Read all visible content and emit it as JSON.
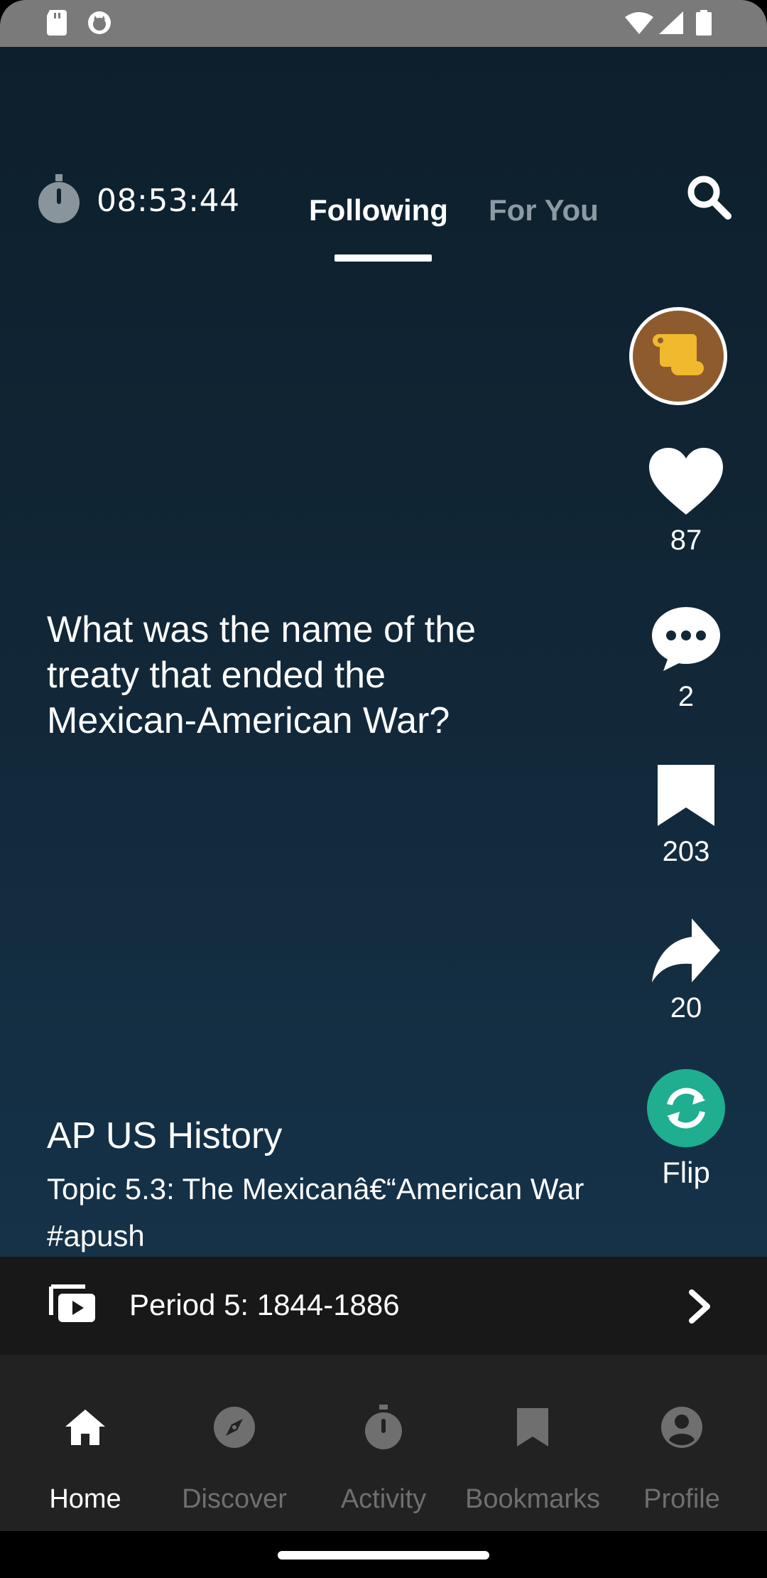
{
  "status_bar": {
    "left_icons": [
      "sd-card-icon",
      "cat-app-icon"
    ],
    "right_icons": [
      "wifi-icon",
      "signal-icon",
      "battery-icon"
    ]
  },
  "header": {
    "timer": "08:53:44",
    "tabs": [
      {
        "label": "Following",
        "active": true
      },
      {
        "label": "For You",
        "active": false
      }
    ],
    "search_icon": "search-icon"
  },
  "card": {
    "question": "What was the name of the treaty that ended the Mexican-American War?",
    "course": "AP US History",
    "topic": "Topic 5.3: The Mexicanâ€“American War #apush"
  },
  "actions": {
    "avatar_icon": "scroll-icon",
    "likes": "87",
    "comments": "2",
    "bookmarks": "203",
    "shares": "20",
    "flip_label": "Flip"
  },
  "playlist": {
    "label": "Period 5: 1844-1886"
  },
  "nav": {
    "items": [
      {
        "label": "Home",
        "icon": "home-icon",
        "active": true
      },
      {
        "label": "Discover",
        "icon": "compass-icon",
        "active": false
      },
      {
        "label": "Activity",
        "icon": "stopwatch-icon",
        "active": false
      },
      {
        "label": "Bookmarks",
        "icon": "bookmark-icon",
        "active": false
      },
      {
        "label": "Profile",
        "icon": "account-icon",
        "active": false
      }
    ]
  },
  "colors": {
    "accent_flip": "#1fae8f",
    "avatar_bg": "#8e5b2e",
    "scroll_gold": "#f0b92e",
    "tab_inactive": "#8d9aa3",
    "nav_inactive": "#6f6f6f"
  }
}
